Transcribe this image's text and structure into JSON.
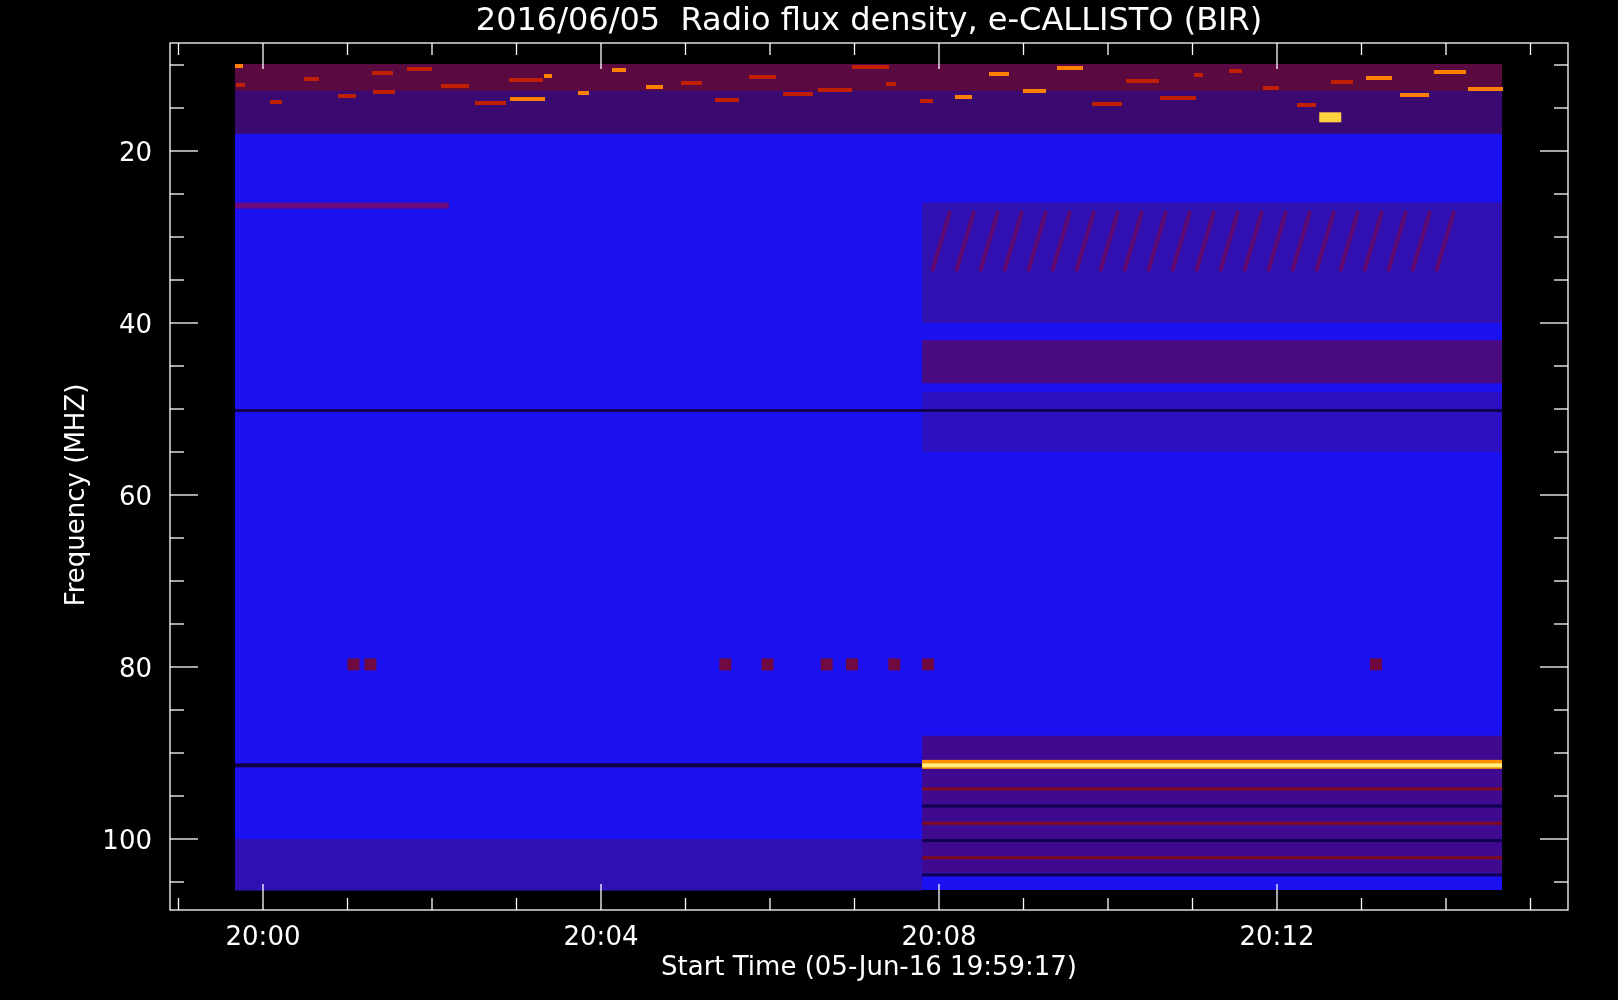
{
  "title": "2016/06/05  Radio flux density, e-CALLISTO (BIR)",
  "y_axis": {
    "label": "Frequency (MHZ)",
    "ticks": [
      "20",
      "40",
      "60",
      "80",
      "100"
    ]
  },
  "x_axis": {
    "label": "Start Time (05-Jun-16 19:59:17)",
    "ticks": [
      "20:00",
      "20:04",
      "20:08",
      "20:12"
    ]
  }
}
